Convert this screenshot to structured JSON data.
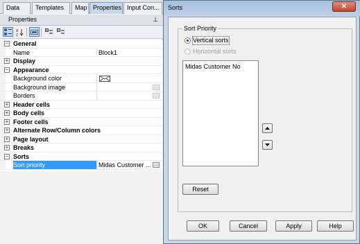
{
  "tabs": [
    "Data",
    "Templates",
    "Map",
    "Properties",
    "Input Con..."
  ],
  "active_tab": "Properties",
  "properties_panel": {
    "title": "Properties",
    "rows": [
      {
        "type": "category",
        "label": "General",
        "expander": "−"
      },
      {
        "type": "property",
        "label": "Name",
        "value": "Block1"
      },
      {
        "type": "category",
        "label": "Display",
        "expander": "+"
      },
      {
        "type": "category",
        "label": "Appearance",
        "expander": "−"
      },
      {
        "type": "property",
        "label": "Background color",
        "value": "",
        "icon": "envelope-icon"
      },
      {
        "type": "property",
        "label": "Background image",
        "value": ""
      },
      {
        "type": "property",
        "label": "Borders",
        "value": ""
      },
      {
        "type": "category",
        "label": "Header cells",
        "expander": "+"
      },
      {
        "type": "category",
        "label": "Body cells",
        "expander": "+"
      },
      {
        "type": "category",
        "label": "Footer cells",
        "expander": "+"
      },
      {
        "type": "category",
        "label": "Alternate Row/Column colors",
        "expander": "+"
      },
      {
        "type": "category",
        "label": "Page layout",
        "expander": "+"
      },
      {
        "type": "category",
        "label": "Breaks",
        "expander": "+"
      },
      {
        "type": "category",
        "label": "Sorts",
        "expander": "−"
      },
      {
        "type": "property",
        "label": "Sort priority",
        "value": "Midas Customer ...",
        "selected": true
      }
    ]
  },
  "dialog": {
    "title": "Sorts",
    "close_label": "✕",
    "group_label": "Sort Priority",
    "radio_vertical": "Vertical sorts",
    "radio_horizontal": "Horizontal sorts",
    "list_items": [
      "Midas Customer No"
    ],
    "reset_label": "Reset",
    "ok_label": "OK",
    "cancel_label": "Cancel",
    "apply_label": "Apply",
    "help_label": "Help"
  },
  "colors": {
    "selection": "#3399ff",
    "dialog_frame": "#c9d6e6",
    "close_button": "#c6452f"
  }
}
